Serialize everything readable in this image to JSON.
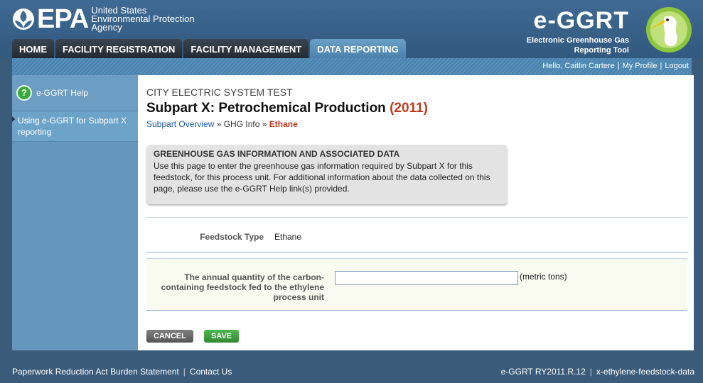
{
  "header": {
    "epa_word": "EPA",
    "agency_lines": [
      "United States",
      "Environmental Protection",
      "Agency"
    ],
    "ggrt_title": "e-GGRT",
    "ggrt_subtitle_1": "Electronic Greenhouse Gas",
    "ggrt_subtitle_2": "Reporting Tool"
  },
  "tabs": [
    {
      "label": "HOME"
    },
    {
      "label": "FACILITY REGISTRATION"
    },
    {
      "label": "FACILITY MANAGEMENT"
    },
    {
      "label": "DATA REPORTING",
      "active": true
    }
  ],
  "userbar": {
    "greeting": "Hello, Caitlin Cartere",
    "profile": "My Profile",
    "logout": "Logout"
  },
  "sidebar": {
    "help_label": "e-GGRT Help",
    "items": [
      {
        "label": "Using e-GGRT for Subpart X reporting"
      }
    ]
  },
  "main": {
    "facility": "CITY ELECTRIC SYSTEM TEST",
    "title": "Subpart X: Petrochemical Production",
    "year": "(2011)",
    "breadcrumb": {
      "link1": "Subpart Overview",
      "sep1": " » ",
      "item2": "GHG Info",
      "sep2": " » ",
      "current": "Ethane"
    },
    "infobox": {
      "heading": "GREENHOUSE GAS INFORMATION AND ASSOCIATED DATA",
      "text": "Use this page to enter the greenhouse gas information required by Subpart X for this feedstock, for this process unit. For additional information about the data collected on this page, please use the e-GGRT Help link(s) provided."
    },
    "feedstock_type_label": "Feedstock Type",
    "feedstock_type_value": "Ethane",
    "quantity_label": "The annual quantity of the carbon-containing feedstock fed to the ethylene process unit",
    "quantity_value": "",
    "quantity_unit": "(metric tons)",
    "cancel_label": "CANCEL",
    "save_label": "SAVE"
  },
  "footer": {
    "paperwork": "Paperwork Reduction Act Burden Statement",
    "contact": "Contact Us",
    "version": "e-GGRT RY2011.R.12",
    "page_id": "x-ethylene-feedstock-data"
  },
  "colors": {
    "accent_blue": "#4a82ad",
    "year_red": "#c0391b",
    "save_green": "#2e8a2e"
  }
}
